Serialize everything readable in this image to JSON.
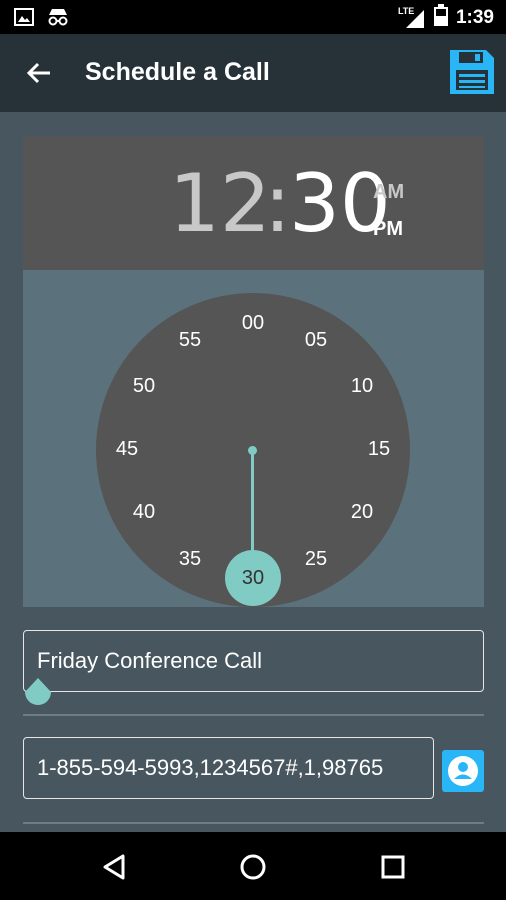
{
  "status_bar": {
    "time": "1:39",
    "network": "LTE",
    "icons": [
      "image-notification-icon",
      "incognito-icon",
      "signal-icon",
      "battery-icon"
    ]
  },
  "app_bar": {
    "title": "Schedule a Call",
    "back_icon": "arrow-left-icon",
    "save_icon": "floppy-disk-icon",
    "save_color": "#29b6f6"
  },
  "time_picker": {
    "hour": "12",
    "separator": ":",
    "minute": "30",
    "am_label": "AM",
    "pm_label": "PM",
    "selected_period": "PM",
    "dial_numbers": [
      "00",
      "05",
      "10",
      "15",
      "20",
      "25",
      "35",
      "40",
      "45",
      "50",
      "55"
    ],
    "selected_minute": "30",
    "accent_color": "#80cbc4"
  },
  "form": {
    "call_name": "Friday Conference Call",
    "phone_number": "1-855-594-5993,1234567#,1,98765",
    "contact_icon": "contact-person-icon"
  },
  "nav_bar": {
    "icons": [
      "back-triangle-icon",
      "home-circle-icon",
      "recents-square-icon"
    ]
  }
}
